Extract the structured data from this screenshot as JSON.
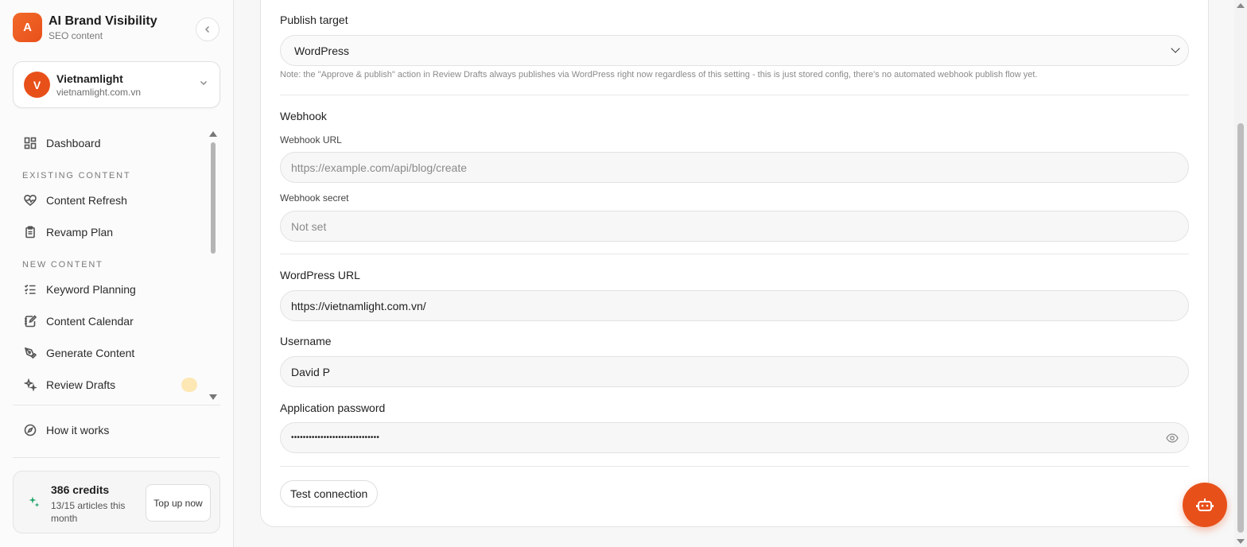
{
  "sidebar": {
    "brand": {
      "logo_letter": "A",
      "title": "AI Brand Visibility",
      "subtitle": "SEO content"
    },
    "project": {
      "avatar_letter": "V",
      "name": "Vietnamlight",
      "domain": "vietnamlight.com.vn"
    },
    "nav": {
      "dashboard": "Dashboard",
      "section_existing": "EXISTING CONTENT",
      "content_refresh": "Content Refresh",
      "revamp_plan": "Revamp Plan",
      "section_new": "NEW CONTENT",
      "keyword_planning": "Keyword Planning",
      "content_calendar": "Content Calendar",
      "generate_content": "Generate Content",
      "review_drafts": "Review Drafts"
    },
    "how_it_works": "How it works",
    "credits": {
      "title": "386 credits",
      "subtitle": "13/15 articles this month",
      "topup": "Top up now"
    }
  },
  "form": {
    "publish_target": {
      "label": "Publish target",
      "value": "WordPress",
      "note": "Note: the \"Approve & publish\" action in Review Drafts always publishes via WordPress right now regardless of this setting - this is just stored config, there's no automated webhook publish flow yet."
    },
    "webhook": {
      "heading": "Webhook",
      "url_label": "Webhook URL",
      "url_placeholder": "https://example.com/api/blog/create",
      "secret_label": "Webhook secret",
      "secret_placeholder": "Not set"
    },
    "wordpress_url": {
      "label": "WordPress URL",
      "value": "https://vietnamlight.com.vn/"
    },
    "username": {
      "label": "Username",
      "value": "David P"
    },
    "app_password": {
      "label": "Application password",
      "value": "••••••••••••••••••••••••••••••"
    },
    "test_connection": "Test connection"
  },
  "colors": {
    "accent": "#e8501a",
    "credits_icon": "#1fa36b"
  }
}
